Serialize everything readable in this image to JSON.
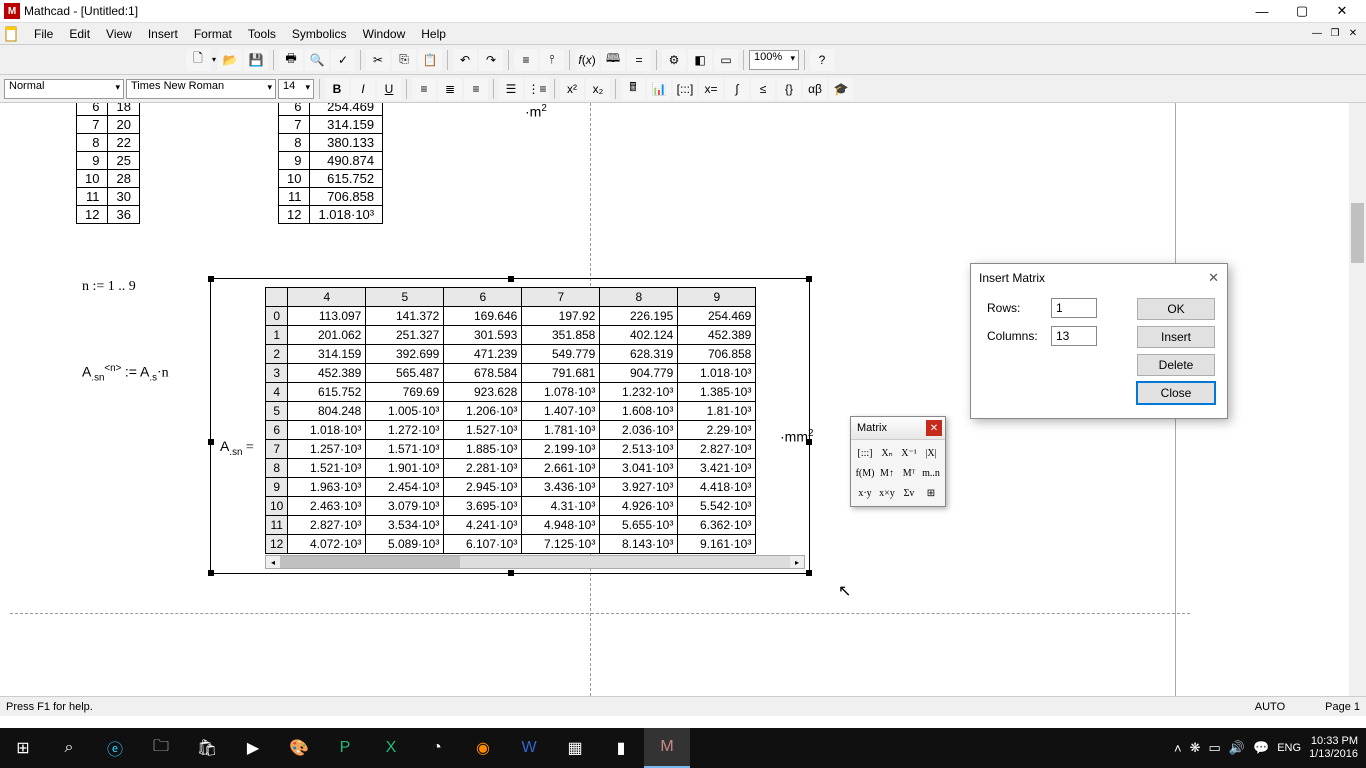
{
  "window": {
    "app_letter": "M",
    "title": "Mathcad - [Untitled:1]"
  },
  "menu": [
    "File",
    "Edit",
    "View",
    "Insert",
    "Format",
    "Tools",
    "Symbolics",
    "Window",
    "Help"
  ],
  "toolbar": {
    "style": "Normal",
    "font": "Times New Roman",
    "size": "14",
    "zoom": "100%"
  },
  "equations": {
    "n_def": "n := 1 .. 9",
    "asn_def_lhs": "A",
    "asn_def": ":= A",
    "asn_result": "A",
    "unit_m": "·m",
    "unit_mm": "·mm"
  },
  "table_left": [
    [
      "6",
      "18"
    ],
    [
      "7",
      "20"
    ],
    [
      "8",
      "22"
    ],
    [
      "9",
      "25"
    ],
    [
      "10",
      "28"
    ],
    [
      "11",
      "30"
    ],
    [
      "12",
      "36"
    ]
  ],
  "table_mid": [
    [
      "6",
      "254.469"
    ],
    [
      "7",
      "314.159"
    ],
    [
      "8",
      "380.133"
    ],
    [
      "9",
      "490.874"
    ],
    [
      "10",
      "615.752"
    ],
    [
      "11",
      "706.858"
    ],
    [
      "12",
      "1.018·10³"
    ]
  ],
  "big_matrix": {
    "cols": [
      "4",
      "5",
      "6",
      "7",
      "8",
      "9"
    ],
    "rows": [
      {
        "i": "0",
        "v": [
          "113.097",
          "141.372",
          "169.646",
          "197.92",
          "226.195",
          "254.469"
        ]
      },
      {
        "i": "1",
        "v": [
          "201.062",
          "251.327",
          "301.593",
          "351.858",
          "402.124",
          "452.389"
        ]
      },
      {
        "i": "2",
        "v": [
          "314.159",
          "392.699",
          "471.239",
          "549.779",
          "628.319",
          "706.858"
        ]
      },
      {
        "i": "3",
        "v": [
          "452.389",
          "565.487",
          "678.584",
          "791.681",
          "904.779",
          "1.018·10³"
        ]
      },
      {
        "i": "4",
        "v": [
          "615.752",
          "769.69",
          "923.628",
          "1.078·10³",
          "1.232·10³",
          "1.385·10³"
        ]
      },
      {
        "i": "5",
        "v": [
          "804.248",
          "1.005·10³",
          "1.206·10³",
          "1.407·10³",
          "1.608·10³",
          "1.81·10³"
        ]
      },
      {
        "i": "6",
        "v": [
          "1.018·10³",
          "1.272·10³",
          "1.527·10³",
          "1.781·10³",
          "2.036·10³",
          "2.29·10³"
        ]
      },
      {
        "i": "7",
        "v": [
          "1.257·10³",
          "1.571·10³",
          "1.885·10³",
          "2.199·10³",
          "2.513·10³",
          "2.827·10³"
        ]
      },
      {
        "i": "8",
        "v": [
          "1.521·10³",
          "1.901·10³",
          "2.281·10³",
          "2.661·10³",
          "3.041·10³",
          "3.421·10³"
        ]
      },
      {
        "i": "9",
        "v": [
          "1.963·10³",
          "2.454·10³",
          "2.945·10³",
          "3.436·10³",
          "3.927·10³",
          "4.418·10³"
        ]
      },
      {
        "i": "10",
        "v": [
          "2.463·10³",
          "3.079·10³",
          "3.695·10³",
          "4.31·10³",
          "4.926·10³",
          "5.542·10³"
        ]
      },
      {
        "i": "11",
        "v": [
          "2.827·10³",
          "3.534·10³",
          "4.241·10³",
          "4.948·10³",
          "5.655·10³",
          "6.362·10³"
        ]
      },
      {
        "i": "12",
        "v": [
          "4.072·10³",
          "5.089·10³",
          "6.107·10³",
          "7.125·10³",
          "8.143·10³",
          "9.161·10³"
        ]
      }
    ]
  },
  "matrix_palette": {
    "title": "Matrix",
    "buttons": [
      "[:::]",
      "Xₙ",
      "X⁻¹",
      "|X|",
      "f(M)",
      "M↑",
      "Mᵀ",
      "m..n",
      "x·y",
      "x×y",
      "Σv",
      "⊞"
    ]
  },
  "dialog": {
    "title": "Insert Matrix",
    "rows_label": "Rows:",
    "rows_value": "1",
    "cols_label": "Columns:",
    "cols_value": "13",
    "ok": "OK",
    "insert": "Insert",
    "delete": "Delete",
    "close": "Close"
  },
  "status": {
    "help": "Press F1 for help.",
    "auto": "AUTO",
    "page": "Page 1"
  },
  "tray": {
    "lang": "ENG",
    "time": "10:33 PM",
    "date": "1/13/2016"
  }
}
